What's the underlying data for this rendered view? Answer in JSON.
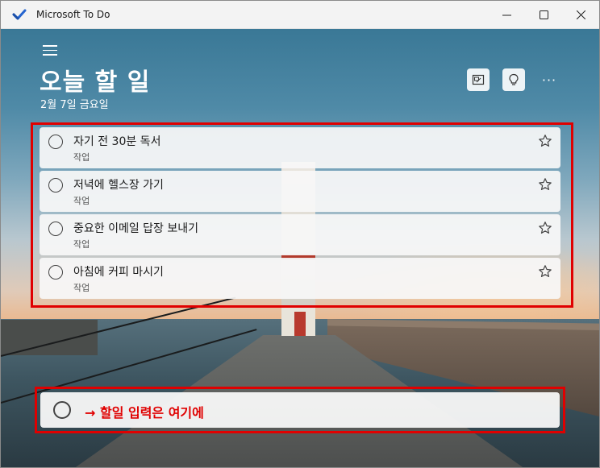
{
  "window": {
    "title": "Microsoft To Do",
    "icon": "checkmark-icon",
    "controls": [
      "minimize-icon",
      "maximize-icon",
      "close-icon"
    ]
  },
  "header": {
    "menu_icon": "hamburger-icon",
    "title": "오늘 할 일",
    "date": "2월 7일 금요일",
    "buttons": [
      "change-background-icon",
      "suggestions-lightbulb-icon",
      "more-options-icon"
    ],
    "more_label": "···"
  },
  "tasks": [
    {
      "title": "자기 전 30분 독서",
      "list": "작업"
    },
    {
      "title": "저녁에 헬스장 가기",
      "list": "작업"
    },
    {
      "title": "중요한 이메일 답장 보내기",
      "list": "작업"
    },
    {
      "title": "아침에 커피 마시기",
      "list": "작업"
    }
  ],
  "add_task": {
    "text": "→ 할일 입력은 여기에"
  },
  "colors": {
    "annotation": "#e00000",
    "accent": "#2564cf"
  }
}
